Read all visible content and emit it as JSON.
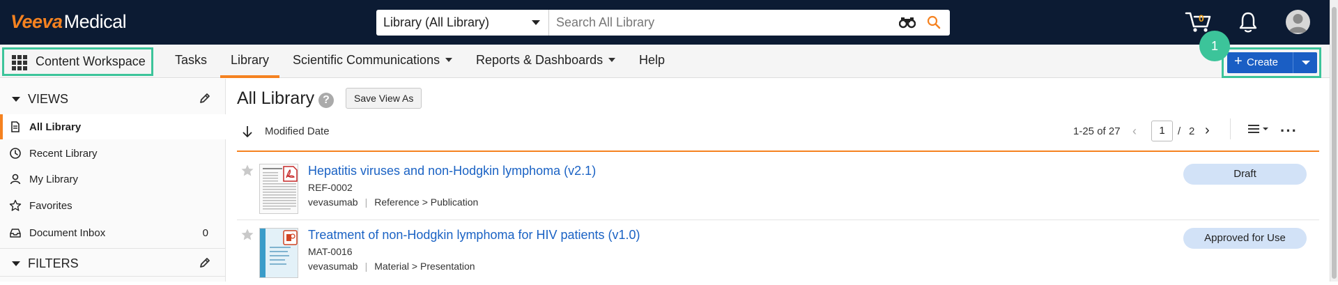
{
  "header": {
    "brand": "Veeva",
    "product": "Medical",
    "search": {
      "scope": "Library (All Library)",
      "placeholder": "Search All Library"
    },
    "cart_count": "0",
    "icons": [
      "binoculars-icon",
      "search-icon",
      "cart-icon",
      "bell-icon",
      "user-avatar-icon"
    ]
  },
  "nav": {
    "workspace": "Content Workspace",
    "items": [
      {
        "label": "Tasks"
      },
      {
        "label": "Library",
        "active": true
      },
      {
        "label": "Scientific Communications",
        "dropdown": true
      },
      {
        "label": "Reports & Dashboards",
        "dropdown": true
      },
      {
        "label": "Help"
      }
    ],
    "create_label": "Create",
    "callout": "1"
  },
  "sidebar": {
    "views_header": "VIEWS",
    "items": [
      {
        "label": "All Library",
        "icon": "document-icon",
        "active": true
      },
      {
        "label": "Recent Library",
        "icon": "clock-icon"
      },
      {
        "label": "My Library",
        "icon": "person-icon"
      },
      {
        "label": "Favorites",
        "icon": "star-icon"
      },
      {
        "label": "Document Inbox",
        "icon": "inbox-icon",
        "count": "0"
      }
    ],
    "filters_header": "FILTERS"
  },
  "main": {
    "title": "All Library",
    "save_view_label": "Save View As",
    "sort_label": "Modified Date",
    "range": "1-25 of 27",
    "page": "1",
    "page_sep": "/",
    "total_pages": "2",
    "documents": [
      {
        "title": "Hepatitis viruses and non-Hodgkin lymphoma (v2.1)",
        "code": "REF-0002",
        "owner": "vevasumab",
        "type": "Reference > Publication",
        "status": "Draft",
        "file_type": "pdf"
      },
      {
        "title": "Treatment of non-Hodgkin lymphoma for HIV patients (v1.0)",
        "code": "MAT-0016",
        "owner": "vevasumab",
        "type": "Material > Presentation",
        "status": "Approved for Use",
        "file_type": "pptx"
      }
    ]
  },
  "colors": {
    "topbar": "#0c1b33",
    "accent_orange": "#f58220",
    "primary_blue": "#1a5ec4",
    "highlight_green": "#3cc49a",
    "badge_bg": "#d2e2f7",
    "link_blue": "#1a62c4"
  }
}
